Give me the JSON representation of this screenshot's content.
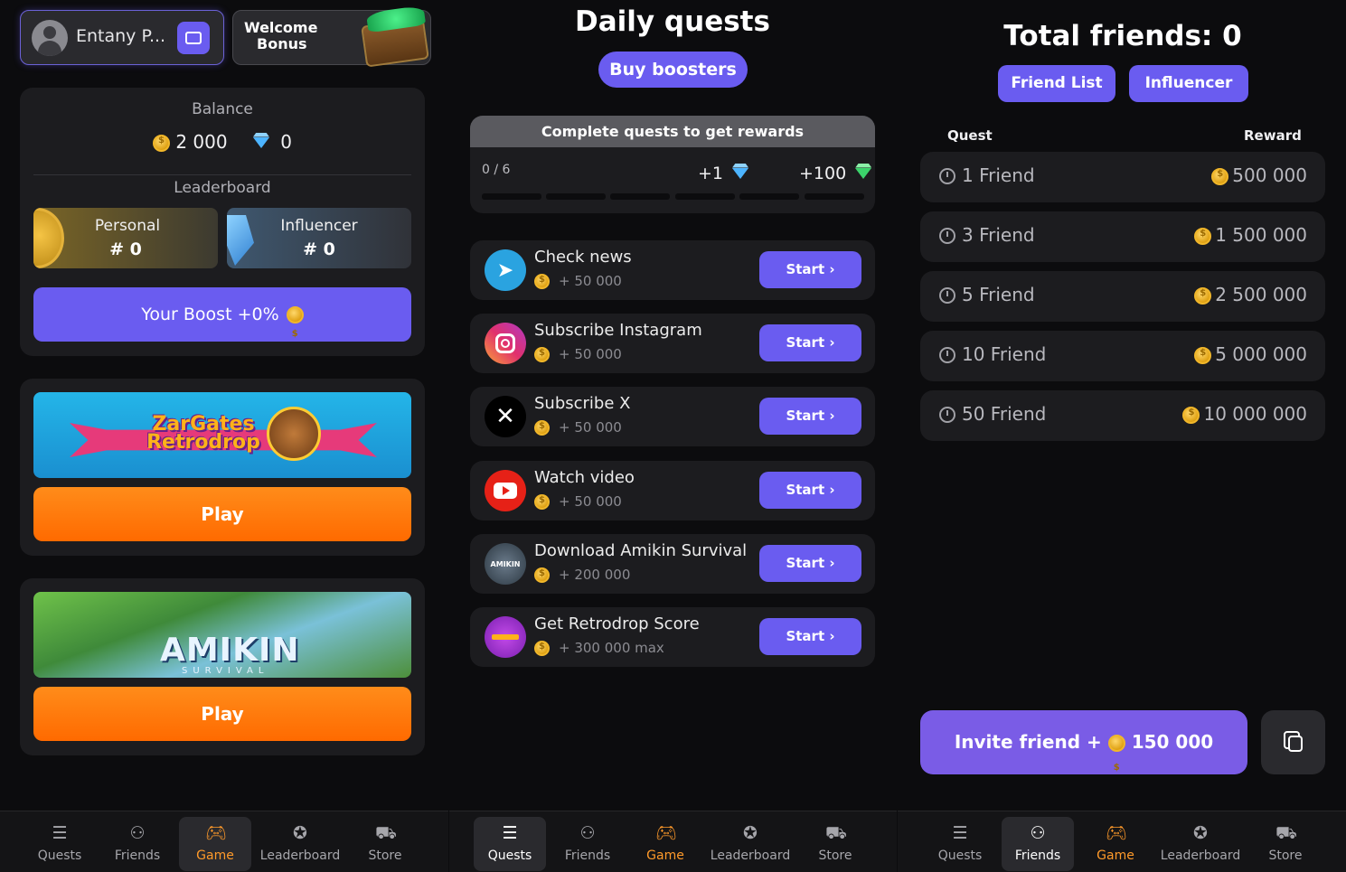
{
  "profile": {
    "name": "Entany P..."
  },
  "welcome_bonus": {
    "line1": "Welcome",
    "line2": "Bonus"
  },
  "balance": {
    "title": "Balance",
    "coins": "2 000",
    "gems": "0",
    "leaderboard_title": "Leaderboard",
    "personal_label": "Personal",
    "personal_rank": "# 0",
    "influencer_label": "Influencer",
    "influencer_rank": "# 0",
    "boost_label": "Your Boost +0%"
  },
  "games": [
    {
      "banner_text": "ZarGates Retrodrop",
      "play_label": "Play"
    },
    {
      "banner_text": "AMIKIN",
      "banner_sub": "SURVIVAL",
      "play_label": "Play"
    }
  ],
  "daily": {
    "title": "Daily quests",
    "buy_boosters": "Buy boosters",
    "progress_header": "Complete quests to get rewards",
    "progress_count": "0 / 6",
    "progress_value": 0,
    "reward_gem": "+1",
    "reward_green": "+100",
    "segments": 6
  },
  "quests": [
    {
      "title": "Check news",
      "reward": "+ 50 000",
      "icon": "telegram-icon",
      "color": "#2aa3e0",
      "start": "Start"
    },
    {
      "title": "Subscribe Instagram",
      "reward": "+ 50 000",
      "icon": "instagram-icon",
      "color": "#e1306c",
      "start": "Start"
    },
    {
      "title": "Subscribe X",
      "reward": "+ 50 000",
      "icon": "x-icon",
      "color": "#000000",
      "start": "Start"
    },
    {
      "title": "Watch video",
      "reward": "+ 50 000",
      "icon": "youtube-icon",
      "color": "#e62117",
      "start": "Start"
    },
    {
      "title": "Download Amikin Survival",
      "reward": "+ 200 000",
      "icon": "amikin-icon",
      "color": "#3c4a55",
      "start": "Start"
    },
    {
      "title": "Get Retrodrop Score",
      "reward": "+ 300 000 max",
      "icon": "retrodrop-icon",
      "color": "#9b2bd9",
      "start": "Start"
    }
  ],
  "friends": {
    "title": "Total friends: 0",
    "friend_list": "Friend List",
    "influencer": "Influencer",
    "col_quest": "Quest",
    "col_reward": "Reward",
    "rows": [
      {
        "label": "1 Friend",
        "reward": "500 000"
      },
      {
        "label": "3 Friend",
        "reward": "1 500 000"
      },
      {
        "label": "5 Friend",
        "reward": "2 500 000"
      },
      {
        "label": "10 Friend",
        "reward": "5 000 000"
      },
      {
        "label": "50 Friend",
        "reward": "10 000 000"
      }
    ],
    "invite_prefix": "Invite friend +",
    "invite_amount": "150 000"
  },
  "nav": {
    "items": [
      "Quests",
      "Friends",
      "Game",
      "Leaderboard",
      "Store"
    ]
  },
  "colors": {
    "accent": "#6a5cf0",
    "orange": "#ff7a0a",
    "game": "#ff9a2a"
  }
}
